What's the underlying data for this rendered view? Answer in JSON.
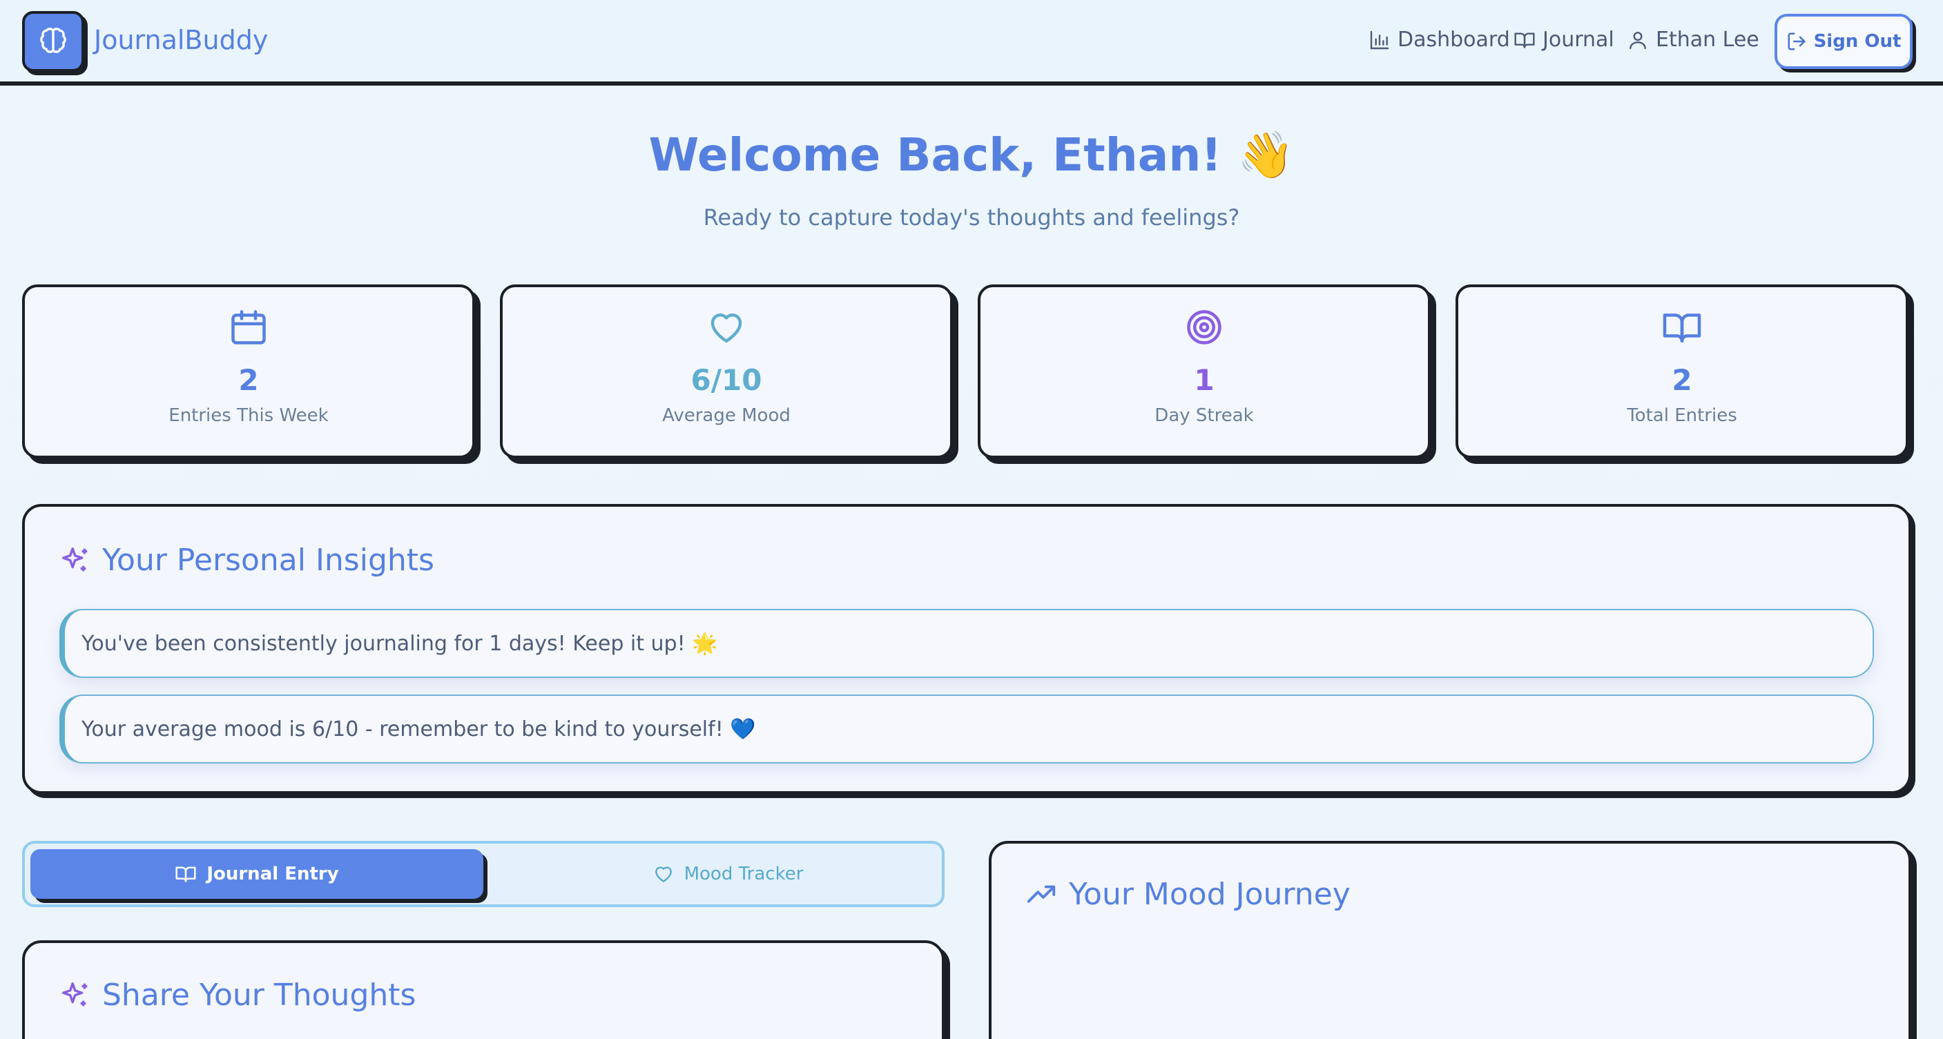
{
  "app": {
    "brand": "JournalBuddy"
  },
  "nav": {
    "dashboard": "Dashboard",
    "journal": "Journal",
    "user": "Ethan Lee",
    "sign_out": "Sign Out"
  },
  "hero": {
    "title": "Welcome Back, Ethan! 👋",
    "subtitle": "Ready to capture today's thoughts and feelings?"
  },
  "stats": [
    {
      "icon": "calendar-icon",
      "value": "2",
      "label": "Entries This Week",
      "color": "#5680e0"
    },
    {
      "icon": "heart-icon",
      "value": "6/10",
      "label": "Average Mood",
      "color": "#5eaed0"
    },
    {
      "icon": "target-icon",
      "value": "1",
      "label": "Day Streak",
      "color": "#8a5ee0"
    },
    {
      "icon": "book-icon",
      "value": "2",
      "label": "Total Entries",
      "color": "#5680e0"
    }
  ],
  "insights": {
    "title": "Your Personal Insights",
    "items": [
      "You've been consistently journaling for 1 days! Keep it up! 🌟",
      "Your average mood is 6/10 - remember to be kind to yourself! 💙"
    ]
  },
  "tabs": {
    "journal_entry": "Journal Entry",
    "mood_tracker": "Mood Tracker"
  },
  "share": {
    "title": "Share Your Thoughts"
  },
  "mood_journey": {
    "title": "Your Mood Journey"
  },
  "colors": {
    "accent": "#5b86e8",
    "border": "#1c1f26",
    "teal": "#5eaed0",
    "purple": "#8a5ee0"
  }
}
